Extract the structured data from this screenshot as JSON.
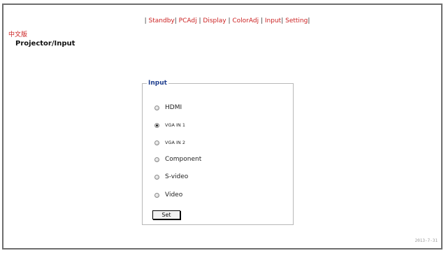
{
  "nav": {
    "items": [
      {
        "label": "Standby"
      },
      {
        "label": "PCAdj"
      },
      {
        "label": "Display"
      },
      {
        "label": "ColorAdj"
      },
      {
        "label": "Input"
      },
      {
        "label": "Setting"
      }
    ],
    "separator": "|"
  },
  "language_link": "中文版",
  "page_title": "Projector/Input",
  "input_group": {
    "legend": "Input",
    "options": [
      {
        "label": "HDMI",
        "checked": false
      },
      {
        "label": "VGA IN 1",
        "checked": true
      },
      {
        "label": "VGA IN 2",
        "checked": false
      },
      {
        "label": "Component",
        "checked": false
      },
      {
        "label": "S-video",
        "checked": false
      },
      {
        "label": "Video",
        "checked": false
      }
    ],
    "set_label": "Set"
  },
  "footer_date": "2013-7-31",
  "colors": {
    "link": "#cc2222",
    "legend": "#1f3f8f",
    "frame": "#6e6e6e",
    "date": "#9a9a9a"
  }
}
